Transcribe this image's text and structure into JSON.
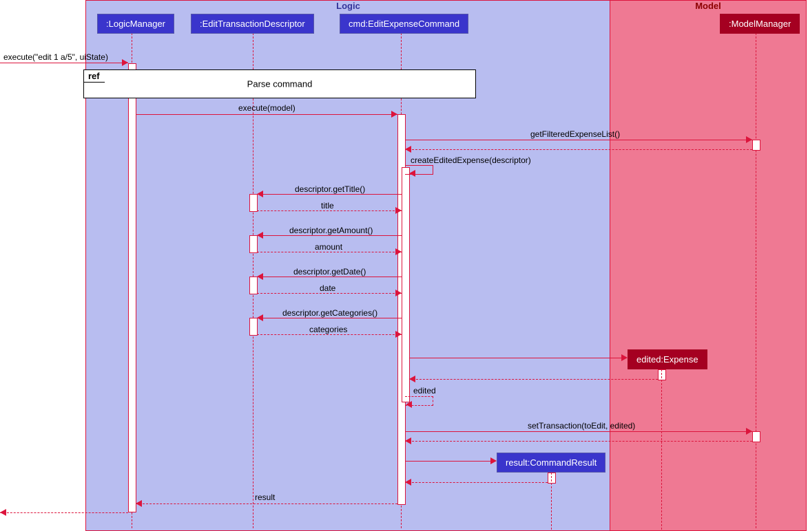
{
  "regions": {
    "logic": "Logic",
    "model": "Model"
  },
  "participants": {
    "logicManager": ":LogicManager",
    "descriptor": ":EditTransactionDescriptor",
    "command": "cmd:EditExpenseCommand",
    "modelManager": ":ModelManager",
    "expense": "edited:Expense",
    "result": "result:CommandResult"
  },
  "messages": {
    "execEntry": "execute(\"edit 1 a/5\", uiState)",
    "refLabel": "ref",
    "refText": "Parse command",
    "execModel": "execute(model)",
    "getFiltered": "getFilteredExpenseList()",
    "createEdited": "createEditedExpense(descriptor)",
    "getTitle": "descriptor.getTitle()",
    "titleReturn": "title",
    "getAmount": "descriptor.getAmount()",
    "amountReturn": "amount",
    "getDate": "descriptor.getDate()",
    "dateReturn": "date",
    "getCategories": "descriptor.getCategories()",
    "categoriesReturn": "categories",
    "editedReturn": "edited",
    "setTransaction": "setTransaction(toEdit, edited)",
    "resultReturn": "result"
  }
}
